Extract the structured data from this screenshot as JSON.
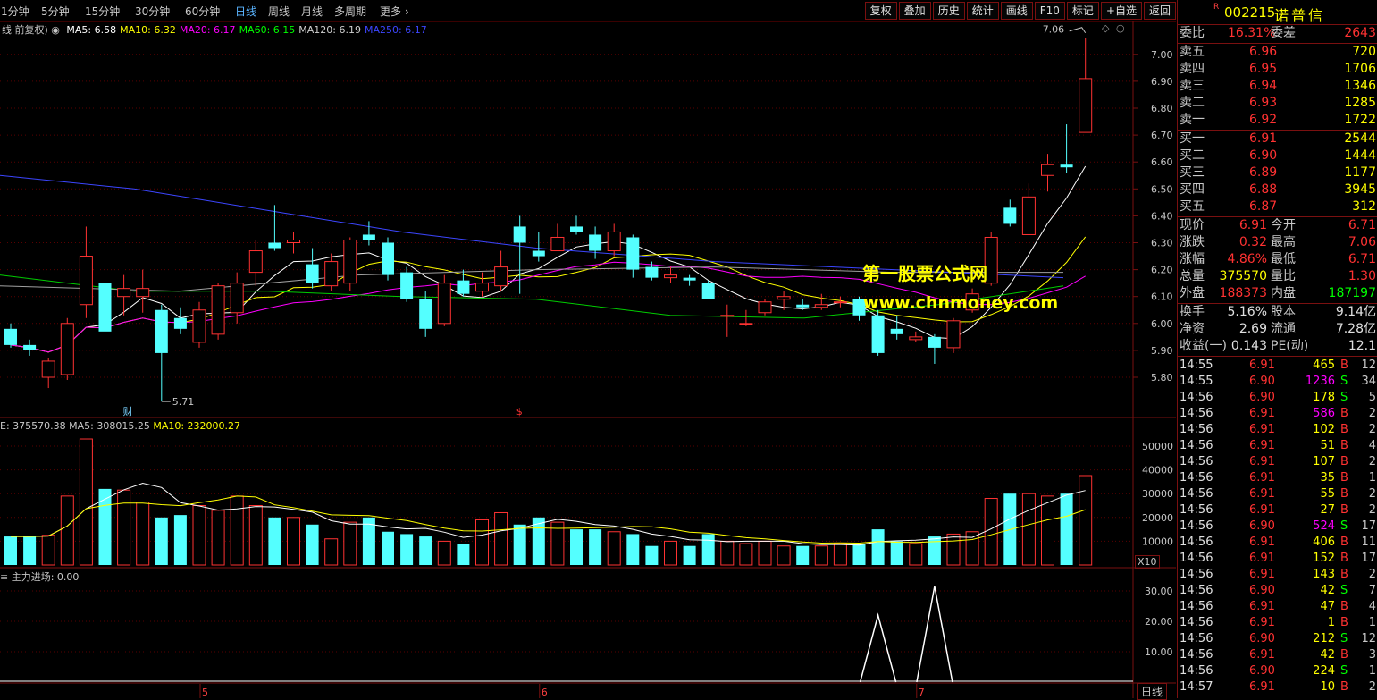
{
  "toolbar": {
    "periods": [
      "1分钟",
      "5分钟",
      "15分钟",
      "30分钟",
      "60分钟",
      "日线",
      "周线",
      "月线",
      "多周期",
      "更多"
    ],
    "active_period": "日线",
    "buttons": [
      "复权",
      "叠加",
      "历史",
      "统计",
      "画线",
      "F10",
      "标记",
      "+自选",
      "返回"
    ]
  },
  "main_chart": {
    "label": "线 前复权)",
    "ma": [
      {
        "name": "MA5",
        "value": "6.58",
        "color": "#ffffff"
      },
      {
        "name": "MA10",
        "value": "6.32",
        "color": "#ffff00"
      },
      {
        "name": "MA20",
        "value": "6.17",
        "color": "#ff00ff"
      },
      {
        "name": "MA60",
        "value": "6.15",
        "color": "#00ff00"
      },
      {
        "name": "MA120",
        "value": "6.19",
        "color": "#cfcfcf"
      },
      {
        "name": "MA250",
        "value": "6.17",
        "color": "#3c46ff"
      }
    ],
    "y_ticks": [
      "7.00",
      "6.90",
      "6.80",
      "6.70",
      "6.60",
      "6.50",
      "6.40",
      "6.30",
      "6.20",
      "6.10",
      "6.00",
      "5.90",
      "5.80"
    ],
    "high_label": "7.06",
    "low_label": "5.71",
    "marker_cai": "财",
    "marker_s": "$"
  },
  "volume_panel": {
    "label": "E: 375570.38",
    "ma5_label": "MA5: 308015.25",
    "ma10_label": "MA10: 232000.27",
    "y_ticks": [
      "50000",
      "40000",
      "30000",
      "20000",
      "10000"
    ],
    "unit": "X10"
  },
  "indicator_panel": {
    "label": "主力进场: 0.00",
    "y_ticks": [
      "30.00",
      "20.00",
      "10.00"
    ]
  },
  "x_axis": {
    "months": [
      "5",
      "6",
      "7"
    ],
    "period_button": "日线"
  },
  "watermark": {
    "line1": "第一股票公式网",
    "line2": "www.chnmoney.com"
  },
  "stock": {
    "code": "002215",
    "name": "诺普信",
    "tag": "R",
    "weibi_label": "委比",
    "weibi": "16.31%",
    "weicha_label": "委差",
    "weicha": "2643",
    "asks": [
      {
        "label": "卖五",
        "price": "6.96",
        "vol": "720"
      },
      {
        "label": "卖四",
        "price": "6.95",
        "vol": "1706"
      },
      {
        "label": "卖三",
        "price": "6.94",
        "vol": "1346"
      },
      {
        "label": "卖二",
        "price": "6.93",
        "vol": "1285"
      },
      {
        "label": "卖一",
        "price": "6.92",
        "vol": "1722"
      }
    ],
    "bids": [
      {
        "label": "买一",
        "price": "6.91",
        "vol": "2544"
      },
      {
        "label": "买二",
        "price": "6.90",
        "vol": "1444"
      },
      {
        "label": "买三",
        "price": "6.89",
        "vol": "1177"
      },
      {
        "label": "买四",
        "price": "6.88",
        "vol": "3945"
      },
      {
        "label": "买五",
        "price": "6.87",
        "vol": "312"
      }
    ],
    "quote": [
      {
        "l1": "现价",
        "v1": "6.91",
        "l2": "今开",
        "v2": "6.71"
      },
      {
        "l1": "涨跌",
        "v1": "0.32",
        "l2": "最高",
        "v2": "7.06"
      },
      {
        "l1": "涨幅",
        "v1": "4.86%",
        "l2": "最低",
        "v2": "6.71"
      },
      {
        "l1": "总量",
        "v1": "375570",
        "l2": "量比",
        "v2": "1.30"
      },
      {
        "l1": "外盘",
        "v1": "188373",
        "l2": "内盘",
        "v2": "187197"
      }
    ],
    "finance": [
      {
        "l1": "换手",
        "v1": "5.16%",
        "l2": "股本",
        "v2": "9.14亿"
      },
      {
        "l1": "净资",
        "v1": "2.69",
        "l2": "流通",
        "v2": "7.28亿"
      },
      {
        "l1": "收益(一)",
        "v1": "0.143",
        "l2": "PE(动)",
        "v2": "12.1"
      }
    ],
    "ticks": [
      {
        "t": "14:55",
        "p": "6.91",
        "v": "465",
        "s": "B",
        "n": "12"
      },
      {
        "t": "14:55",
        "p": "6.90",
        "v": "1236",
        "s": "S",
        "n": "34"
      },
      {
        "t": "14:56",
        "p": "6.90",
        "v": "178",
        "s": "S",
        "n": "5"
      },
      {
        "t": "14:56",
        "p": "6.91",
        "v": "586",
        "s": "B",
        "n": "2"
      },
      {
        "t": "14:56",
        "p": "6.91",
        "v": "102",
        "s": "B",
        "n": "2"
      },
      {
        "t": "14:56",
        "p": "6.91",
        "v": "51",
        "s": "B",
        "n": "4"
      },
      {
        "t": "14:56",
        "p": "6.91",
        "v": "107",
        "s": "B",
        "n": "2"
      },
      {
        "t": "14:56",
        "p": "6.91",
        "v": "35",
        "s": "B",
        "n": "1"
      },
      {
        "t": "14:56",
        "p": "6.91",
        "v": "55",
        "s": "B",
        "n": "2"
      },
      {
        "t": "14:56",
        "p": "6.91",
        "v": "27",
        "s": "B",
        "n": "2"
      },
      {
        "t": "14:56",
        "p": "6.90",
        "v": "524",
        "s": "S",
        "n": "17"
      },
      {
        "t": "14:56",
        "p": "6.91",
        "v": "406",
        "s": "B",
        "n": "11"
      },
      {
        "t": "14:56",
        "p": "6.91",
        "v": "152",
        "s": "B",
        "n": "17"
      },
      {
        "t": "14:56",
        "p": "6.91",
        "v": "143",
        "s": "B",
        "n": "2"
      },
      {
        "t": "14:56",
        "p": "6.90",
        "v": "42",
        "s": "S",
        "n": "7"
      },
      {
        "t": "14:56",
        "p": "6.91",
        "v": "47",
        "s": "B",
        "n": "4"
      },
      {
        "t": "14:56",
        "p": "6.91",
        "v": "1",
        "s": "B",
        "n": "1"
      },
      {
        "t": "14:56",
        "p": "6.90",
        "v": "212",
        "s": "S",
        "n": "12"
      },
      {
        "t": "14:56",
        "p": "6.91",
        "v": "42",
        "s": "B",
        "n": "3"
      },
      {
        "t": "14:56",
        "p": "6.90",
        "v": "224",
        "s": "S",
        "n": "1"
      },
      {
        "t": "14:57",
        "p": "6.91",
        "v": "10",
        "s": "B",
        "n": "2"
      }
    ]
  },
  "chart_data": {
    "type": "candlestick",
    "price_ylim": [
      5.71,
      7.06
    ],
    "candles": [
      [
        5.98,
        5.92,
        6.0,
        5.91
      ],
      [
        5.92,
        5.9,
        5.94,
        5.88
      ],
      [
        5.8,
        5.86,
        5.87,
        5.76
      ],
      [
        5.81,
        6.0,
        6.02,
        5.79
      ],
      [
        6.07,
        6.25,
        6.36,
        6.02
      ],
      [
        6.15,
        5.97,
        6.17,
        5.93
      ],
      [
        6.1,
        6.13,
        6.18,
        6.03
      ],
      [
        6.1,
        6.13,
        6.2,
        6.04
      ],
      [
        6.05,
        5.89,
        6.07,
        5.71
      ],
      [
        6.02,
        5.98,
        6.06,
        5.96
      ],
      [
        5.93,
        6.05,
        6.08,
        5.91
      ],
      [
        5.96,
        6.14,
        6.15,
        5.94
      ],
      [
        6.04,
        6.15,
        6.19,
        6.0
      ],
      [
        6.19,
        6.27,
        6.31,
        6.14
      ],
      [
        6.3,
        6.28,
        6.44,
        6.27
      ],
      [
        6.3,
        6.31,
        6.34,
        6.26
      ],
      [
        6.22,
        6.15,
        6.28,
        6.13
      ],
      [
        6.14,
        6.23,
        6.26,
        6.12
      ],
      [
        6.15,
        6.31,
        6.32,
        6.12
      ],
      [
        6.33,
        6.31,
        6.38,
        6.29
      ],
      [
        6.3,
        6.18,
        6.32,
        6.16
      ],
      [
        6.19,
        6.09,
        6.21,
        6.08
      ],
      [
        6.09,
        5.98,
        6.12,
        5.95
      ],
      [
        6.0,
        6.15,
        6.18,
        5.99
      ],
      [
        6.16,
        6.11,
        6.2,
        6.1
      ],
      [
        6.12,
        6.15,
        6.19,
        6.1
      ],
      [
        6.14,
        6.21,
        6.27,
        6.12
      ],
      [
        6.36,
        6.3,
        6.4,
        6.11
      ],
      [
        6.27,
        6.25,
        6.34,
        6.23
      ],
      [
        6.27,
        6.32,
        6.37,
        6.29
      ],
      [
        6.36,
        6.34,
        6.4,
        6.33
      ],
      [
        6.33,
        6.27,
        6.36,
        6.24
      ],
      [
        6.27,
        6.34,
        6.37,
        6.25
      ],
      [
        6.32,
        6.2,
        6.33,
        6.17
      ],
      [
        6.21,
        6.17,
        6.23,
        6.16
      ],
      [
        6.17,
        6.18,
        6.21,
        6.15
      ],
      [
        6.17,
        6.16,
        6.18,
        6.14
      ],
      [
        6.15,
        6.09,
        6.16,
        6.09
      ],
      [
        6.03,
        6.03,
        6.07,
        5.95
      ],
      [
        6.0,
        6.0,
        6.05,
        5.99
      ],
      [
        6.04,
        6.08,
        6.09,
        6.03
      ],
      [
        6.09,
        6.1,
        6.12,
        6.05
      ],
      [
        6.07,
        6.06,
        6.09,
        6.05
      ],
      [
        6.06,
        6.07,
        6.11,
        6.05
      ],
      [
        6.08,
        6.08,
        6.1,
        6.06
      ],
      [
        6.09,
        6.03,
        6.1,
        6.01
      ],
      [
        6.03,
        5.89,
        6.05,
        5.88
      ],
      [
        5.98,
        5.96,
        6.03,
        5.94
      ],
      [
        5.94,
        5.95,
        5.97,
        5.93
      ],
      [
        5.95,
        5.91,
        5.96,
        5.85
      ],
      [
        5.91,
        6.01,
        6.02,
        5.89
      ],
      [
        6.05,
        6.11,
        6.13,
        6.04
      ],
      [
        6.15,
        6.32,
        6.34,
        6.14
      ],
      [
        6.43,
        6.37,
        6.46,
        6.36
      ],
      [
        6.33,
        6.47,
        6.52,
        6.35
      ],
      [
        6.55,
        6.59,
        6.63,
        6.49
      ],
      [
        6.59,
        6.58,
        6.74,
        6.56
      ],
      [
        6.71,
        6.91,
        7.06,
        6.71
      ]
    ],
    "volume": [
      120,
      120,
      125,
      290,
      530,
      320,
      315,
      265,
      200,
      210,
      250,
      230,
      290,
      250,
      200,
      200,
      170,
      110,
      180,
      200,
      140,
      130,
      120,
      100,
      90,
      190,
      220,
      170,
      200,
      180,
      150,
      150,
      140,
      130,
      80,
      100,
      80,
      130,
      100,
      90,
      100,
      80,
      80,
      80,
      90,
      90,
      150,
      100,
      90,
      120,
      130,
      140,
      280,
      300,
      300,
      290,
      300,
      376
    ],
    "vol_ylim": [
      0,
      550
    ],
    "indicator_peaks": [
      {
        "index": 46,
        "value": 22
      },
      {
        "index": 49,
        "value": 31.5
      }
    ],
    "indicator_ylim": [
      0,
      35
    ]
  }
}
